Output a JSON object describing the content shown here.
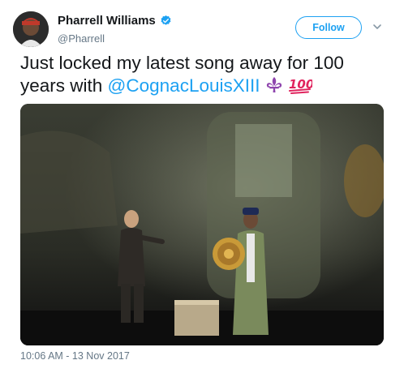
{
  "author": {
    "display_name": "Pharrell Williams",
    "handle": "@Pharrell",
    "verified": true
  },
  "actions": {
    "follow_label": "Follow",
    "menu_icon": "chevron-down-icon"
  },
  "tweet": {
    "text_before": "Just locked my latest song away for 100 years with ",
    "mention": "@CognacLouisXIII",
    "emojis": [
      "fleur-de-lis",
      "hundred-points"
    ],
    "hundred_text": "100"
  },
  "media": {
    "kind": "photo",
    "description_icon": "photo"
  },
  "meta": {
    "timestamp": "10:06 AM - 13 Nov 2017"
  },
  "colors": {
    "accent": "#1da1f2",
    "text": "#14171a",
    "secondary": "#657786",
    "emoji_fleur": "#8e44ad",
    "emoji_hundred": "#e0245e"
  }
}
